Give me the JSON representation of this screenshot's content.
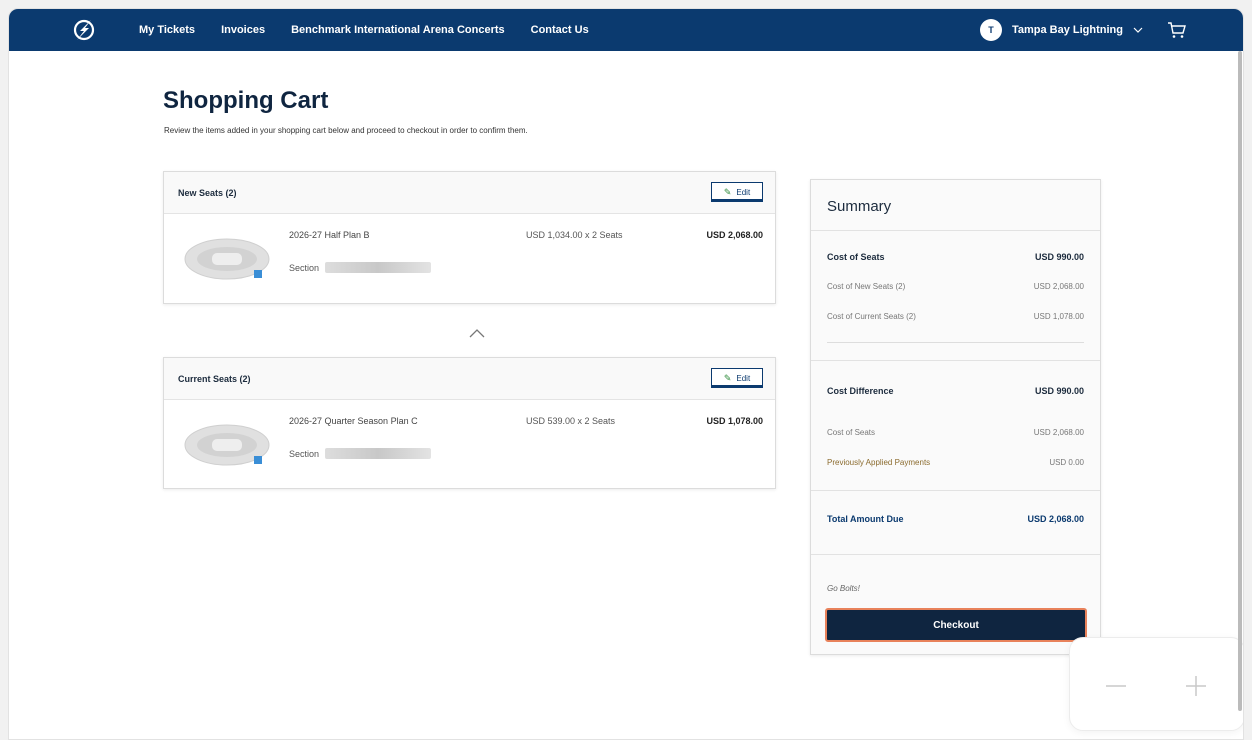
{
  "nav": {
    "links": [
      "My Tickets",
      "Invoices",
      "Benchmark International Arena Concerts",
      "Contact Us"
    ],
    "account_initial": "T",
    "account_name": "Tampa Bay Lightning"
  },
  "page": {
    "title": "Shopping Cart",
    "subtitle": "Review the items added in your shopping cart below and proceed to checkout in order to confirm them."
  },
  "new_seats": {
    "header": "New Seats (2)",
    "edit_label": "Edit",
    "item_name": "2026-27 Half Plan B",
    "section_label": "Section",
    "price": "USD 1,034.00 x 2 Seats",
    "total": "USD 2,068.00"
  },
  "current_seats": {
    "header": "Current Seats (2)",
    "edit_label": "Edit",
    "item_name": "2026-27 Quarter Season Plan C",
    "section_label": "Section",
    "price": "USD 539.00 x 2 Seats",
    "total": "USD 1,078.00"
  },
  "summary": {
    "title": "Summary",
    "cost_of_seats_label": "Cost of Seats",
    "cost_of_seats_value": "USD 990.00",
    "cost_new_label": "Cost of New Seats (2)",
    "cost_new_value": "USD 2,068.00",
    "cost_current_label": "Cost of Current Seats (2)",
    "cost_current_value": "USD 1,078.00",
    "cost_diff_label": "Cost Difference",
    "cost_diff_value": "USD 990.00",
    "cost_seats2_label": "Cost of Seats",
    "cost_seats2_value": "USD 2,068.00",
    "prev_payments_label": "Previously Applied Payments",
    "prev_payments_value": "USD 0.00",
    "total_due_label": "Total Amount Due",
    "total_due_value": "USD 2,068.00",
    "note": "Go Bolts!",
    "checkout_label": "Checkout"
  },
  "colors": {
    "nav_bg": "#0b3a6f",
    "checkout_bg": "#0f2540",
    "checkout_border": "#e8825b"
  },
  "icons": [
    "lightning-bolt-logo-icon",
    "chevron-down-icon",
    "cart-icon",
    "pencil-icon",
    "chevron-up-icon",
    "arena-map-icon",
    "minus-icon",
    "plus-icon"
  ]
}
